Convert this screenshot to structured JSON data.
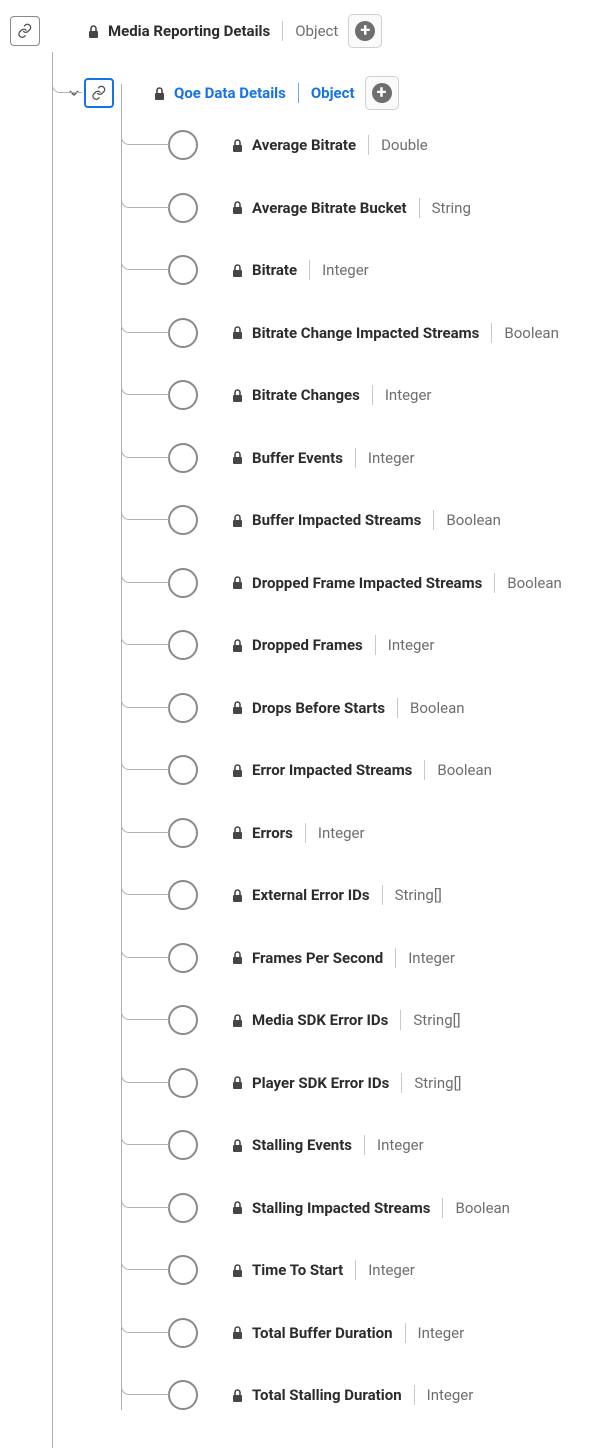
{
  "root": {
    "label": "Media Reporting Details",
    "type": "Object"
  },
  "child": {
    "label": "Qoe Data Details",
    "type": "Object"
  },
  "fields": [
    {
      "label": "Average Bitrate",
      "type": "Double"
    },
    {
      "label": "Average Bitrate Bucket",
      "type": "String"
    },
    {
      "label": "Bitrate",
      "type": "Integer"
    },
    {
      "label": "Bitrate Change Impacted Streams",
      "type": "Boolean"
    },
    {
      "label": "Bitrate Changes",
      "type": "Integer"
    },
    {
      "label": "Buffer Events",
      "type": "Integer"
    },
    {
      "label": "Buffer Impacted Streams",
      "type": "Boolean"
    },
    {
      "label": "Dropped Frame Impacted Streams",
      "type": "Boolean"
    },
    {
      "label": "Dropped Frames",
      "type": "Integer"
    },
    {
      "label": "Drops Before Starts",
      "type": "Boolean"
    },
    {
      "label": "Error Impacted Streams",
      "type": "Boolean"
    },
    {
      "label": "Errors",
      "type": "Integer"
    },
    {
      "label": "External Error IDs",
      "type": "String[]"
    },
    {
      "label": "Frames Per Second",
      "type": "Integer"
    },
    {
      "label": "Media SDK Error IDs",
      "type": "String[]"
    },
    {
      "label": "Player SDK Error IDs",
      "type": "String[]"
    },
    {
      "label": "Stalling Events",
      "type": "Integer"
    },
    {
      "label": "Stalling Impacted Streams",
      "type": "Boolean"
    },
    {
      "label": "Time To Start",
      "type": "Integer"
    },
    {
      "label": "Total Buffer Duration",
      "type": "Integer"
    },
    {
      "label": "Total Stalling Duration",
      "type": "Integer"
    }
  ]
}
